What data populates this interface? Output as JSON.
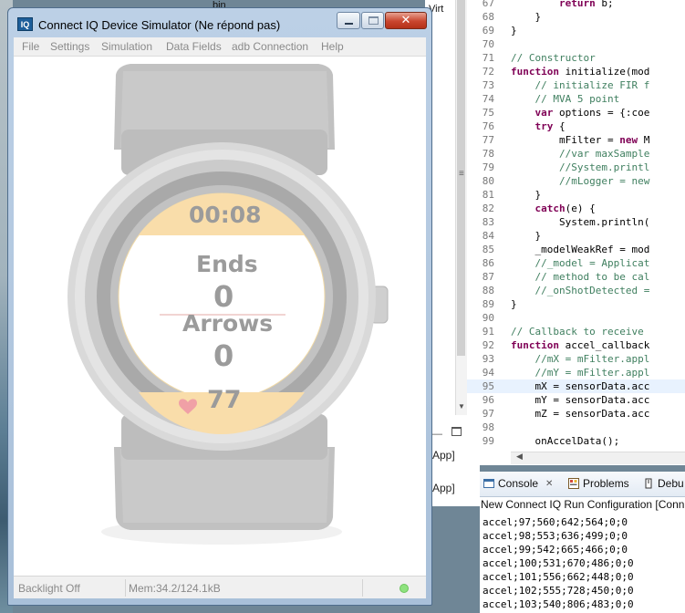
{
  "window": {
    "title": "Connect IQ Device Simulator (Ne répond pas)",
    "app_icon_text": "IQ",
    "minimize_label": "",
    "close_label": "✕"
  },
  "menu": [
    "File",
    "Settings",
    "Simulation",
    "Data Fields",
    "adb Connection",
    "Help"
  ],
  "watch": {
    "timer": "00:08",
    "ends_label": "Ends",
    "ends_value": "0",
    "arrows_label": "Arrows",
    "arrows_value": "0",
    "heart_rate": "77",
    "heart_icon": "heart-icon"
  },
  "statusbar": {
    "backlight": "Backlight Off",
    "memory": "Mem:34.2/124.1kB",
    "status_color": "#8ee27e"
  },
  "editor": {
    "lines": [
      {
        "n": "67",
        "code": "        return b;",
        "kind": "kw-return"
      },
      {
        "n": "68",
        "code": "    }",
        "kind": "tx"
      },
      {
        "n": "69",
        "code": "}",
        "kind": "tx"
      },
      {
        "n": "70",
        "code": "",
        "kind": "tx"
      },
      {
        "n": "71",
        "code": "// Constructor",
        "kind": "cm"
      },
      {
        "n": "72",
        "code": "function initialize(mod",
        "kind": "kw-function"
      },
      {
        "n": "73",
        "code": "    // initialize FIR f",
        "kind": "cm"
      },
      {
        "n": "74",
        "code": "    // MVA 5 point",
        "kind": "cm"
      },
      {
        "n": "75",
        "code": "    var options = {:coe",
        "kind": "kw-var"
      },
      {
        "n": "76",
        "code": "    try {",
        "kind": "kw-try"
      },
      {
        "n": "77",
        "code": "        mFilter = new M",
        "kind": "kw-new"
      },
      {
        "n": "78",
        "code": "        //var maxSample",
        "kind": "cm"
      },
      {
        "n": "79",
        "code": "        //System.printl",
        "kind": "cm"
      },
      {
        "n": "80",
        "code": "        //mLogger = new",
        "kind": "cm"
      },
      {
        "n": "81",
        "code": "    }",
        "kind": "tx"
      },
      {
        "n": "82",
        "code": "    catch(e) {",
        "kind": "kw-catch"
      },
      {
        "n": "83",
        "code": "        System.println(",
        "kind": "tx"
      },
      {
        "n": "84",
        "code": "    }",
        "kind": "tx"
      },
      {
        "n": "85",
        "code": "    _modelWeakRef = mod",
        "kind": "tx"
      },
      {
        "n": "86",
        "code": "    //_model = Applicat",
        "kind": "cm"
      },
      {
        "n": "87",
        "code": "    // method to be cal",
        "kind": "cm"
      },
      {
        "n": "88",
        "code": "    //_onShotDetected =",
        "kind": "cm"
      },
      {
        "n": "89",
        "code": "}",
        "kind": "tx"
      },
      {
        "n": "90",
        "code": "",
        "kind": "tx"
      },
      {
        "n": "91",
        "code": "// Callback to receive",
        "kind": "cm"
      },
      {
        "n": "92",
        "code": "function accel_callback",
        "kind": "kw-function"
      },
      {
        "n": "93",
        "code": "    //mX = mFilter.appl",
        "kind": "cm"
      },
      {
        "n": "94",
        "code": "    //mY = mFilter.appl",
        "kind": "cm"
      },
      {
        "n": "95",
        "code": "    mX = sensorData.acc",
        "kind": "tx"
      },
      {
        "n": "96",
        "code": "    mY = sensorData.acc",
        "kind": "tx"
      },
      {
        "n": "97",
        "code": "    mZ = sensorData.acc",
        "kind": "tx"
      },
      {
        "n": "98",
        "code": "",
        "kind": "tx"
      },
      {
        "n": "99",
        "code": "    onAccelData();",
        "kind": "tx"
      }
    ],
    "highlight_line": "95"
  },
  "left_panel": [
    "App]",
    "App]"
  ],
  "console": {
    "tabs": [
      {
        "label": "Console",
        "icon": "console-icon",
        "close": "✕"
      },
      {
        "label": "Problems",
        "icon": "problems-icon"
      },
      {
        "label": "Debu",
        "icon": "debug-icon"
      }
    ],
    "title": "New Connect IQ Run Configuration [Conn",
    "lines": [
      "accel;97;560;642;564;0;0",
      "accel;98;553;636;499;0;0",
      "accel;99;542;665;466;0;0",
      "accel;100;531;670;486;0;0",
      "accel;101;556;662;448;0;0",
      "accel;102;555;728;450;0;0",
      "accel;103;540;806;483;0;0"
    ]
  },
  "desktop": {
    "top_label": "bin",
    "vir_label": "Virt"
  }
}
